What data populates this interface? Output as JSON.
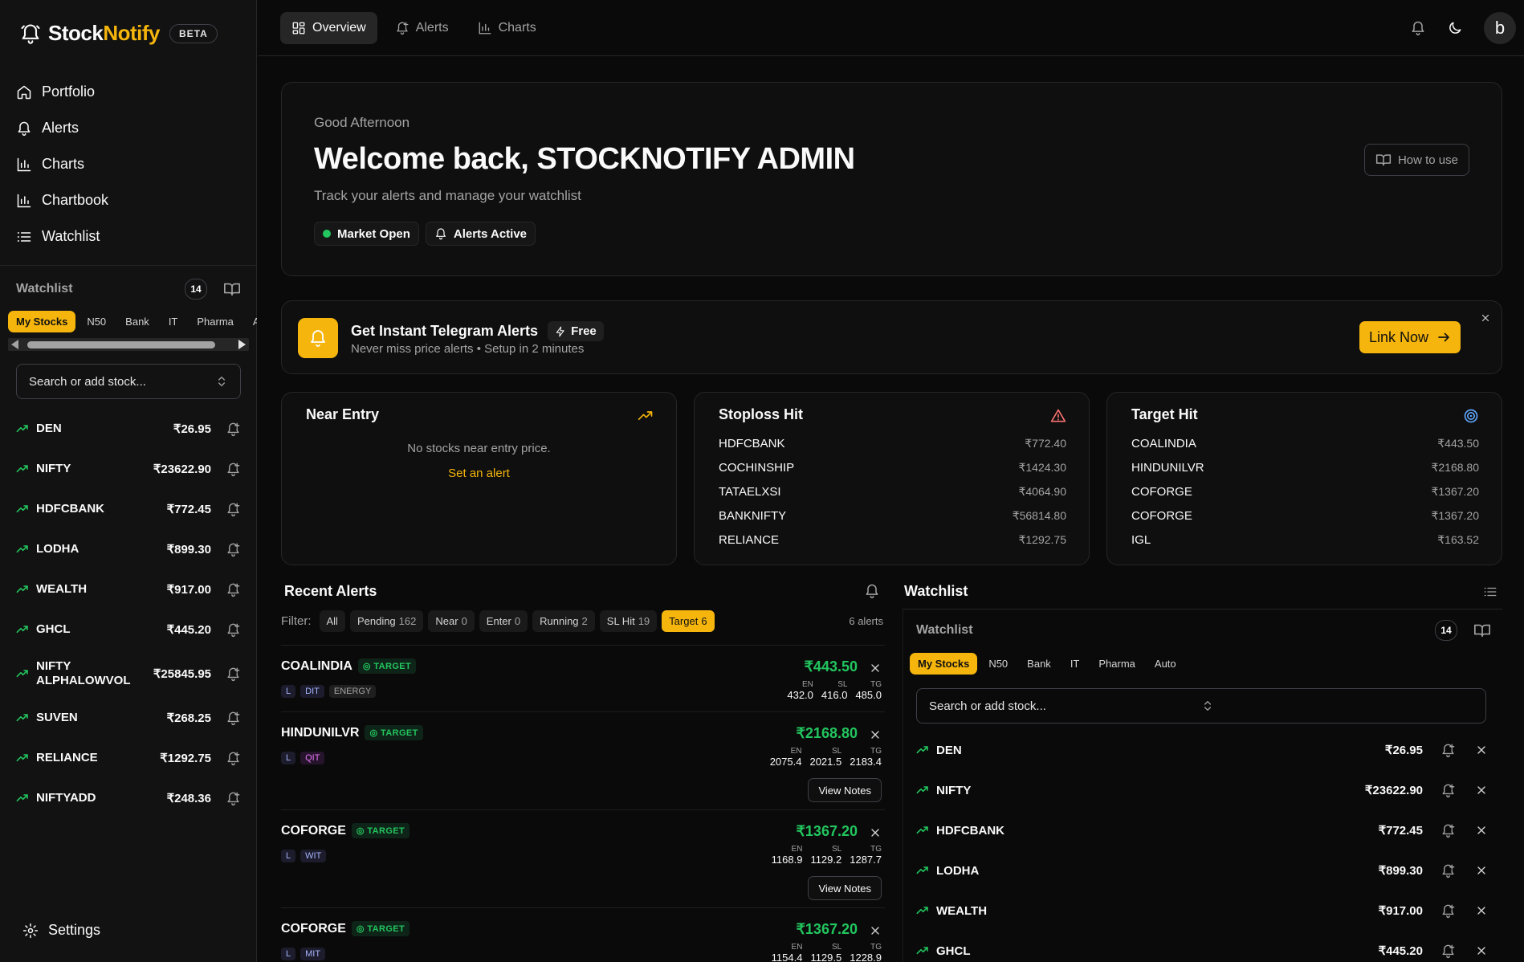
{
  "brand": {
    "name_a": "Stock",
    "name_b": "Notify",
    "badge": "BETA"
  },
  "colors": {
    "accent": "#f5b50c",
    "success": "#22c55e",
    "danger": "#f87171",
    "info": "#60a5fa",
    "bg": "#0a0a0a"
  },
  "nav": [
    {
      "label": "Portfolio",
      "icon": "home-icon"
    },
    {
      "label": "Alerts",
      "icon": "bell-icon"
    },
    {
      "label": "Charts",
      "icon": "bar-chart-icon"
    },
    {
      "label": "Chartbook",
      "icon": "bar-chart-icon"
    },
    {
      "label": "Watchlist",
      "icon": "list-icon"
    }
  ],
  "sidebar_watchlist": {
    "title": "Watchlist",
    "count": "14",
    "chips": [
      "My Stocks",
      "N50",
      "Bank",
      "IT",
      "Pharma",
      "A"
    ],
    "search_placeholder": "Search or add stock...",
    "stocks": [
      {
        "name": "DEN",
        "price": "₹26.95"
      },
      {
        "name": "NIFTY",
        "price": "₹23622.90"
      },
      {
        "name": "HDFCBANK",
        "price": "₹772.45"
      },
      {
        "name": "LODHA",
        "price": "₹899.30"
      },
      {
        "name": "WEALTH",
        "price": "₹917.00"
      },
      {
        "name": "GHCL",
        "price": "₹445.20"
      },
      {
        "name": "NIFTY ALPHALOWVOL",
        "price": "₹25845.95"
      },
      {
        "name": "SUVEN",
        "price": "₹268.25"
      },
      {
        "name": "RELIANCE",
        "price": "₹1292.75"
      },
      {
        "name": "NIFTYADD",
        "price": "₹248.36"
      }
    ]
  },
  "settings_label": "Settings",
  "topbar": {
    "tabs": [
      {
        "label": "Overview",
        "icon": "grid-icon"
      },
      {
        "label": "Alerts",
        "icon": "bell-plus-icon"
      },
      {
        "label": "Charts",
        "icon": "bar-chart-icon"
      }
    ],
    "avatar_letter": "b"
  },
  "welcome": {
    "greeting": "Good Afternoon",
    "title": "Welcome back, STOCKNOTIFY ADMIN",
    "subtitle": "Track your alerts and manage your watchlist",
    "market_badge": "Market Open",
    "alerts_badge": "Alerts Active",
    "howto_label": "How to use"
  },
  "telegram": {
    "title": "Get Instant Telegram Alerts",
    "free_label": "Free",
    "subtitle": "Never miss price alerts • Setup in 2 minutes",
    "button": "Link Now"
  },
  "near_entry": {
    "title": "Near Entry",
    "empty": "No stocks near entry price.",
    "link": "Set an alert"
  },
  "stoploss": {
    "title": "Stoploss Hit",
    "items": [
      {
        "name": "HDFCBANK",
        "price": "₹772.40"
      },
      {
        "name": "COCHINSHIP",
        "price": "₹1424.30"
      },
      {
        "name": "TATAELXSI",
        "price": "₹4064.90"
      },
      {
        "name": "BANKNIFTY",
        "price": "₹56814.80"
      },
      {
        "name": "RELIANCE",
        "price": "₹1292.75"
      }
    ]
  },
  "target": {
    "title": "Target Hit",
    "items": [
      {
        "name": "COALINDIA",
        "price": "₹443.50"
      },
      {
        "name": "HINDUNILVR",
        "price": "₹2168.80"
      },
      {
        "name": "COFORGE",
        "price": "₹1367.20"
      },
      {
        "name": "COFORGE",
        "price": "₹1367.20"
      },
      {
        "name": "IGL",
        "price": "₹163.52"
      }
    ]
  },
  "recent_alerts": {
    "title": "Recent Alerts",
    "filter_label": "Filter:",
    "filters": [
      {
        "label": "All",
        "count": ""
      },
      {
        "label": "Pending",
        "count": "162"
      },
      {
        "label": "Near",
        "count": "0"
      },
      {
        "label": "Enter",
        "count": "0"
      },
      {
        "label": "Running",
        "count": "2"
      },
      {
        "label": "SL Hit",
        "count": "19"
      },
      {
        "label": "Target",
        "count": "6"
      }
    ],
    "count_text": "6 alerts",
    "level_labels": {
      "en": "EN",
      "sl": "SL",
      "tg": "TG"
    },
    "view_notes": "View Notes",
    "items": [
      {
        "name": "COALINDIA",
        "status": "TARGET",
        "tags": [
          "L",
          "DIT",
          "ENERGY"
        ],
        "price": "₹443.50",
        "en": "432.0",
        "sl": "416.0",
        "tg": "485.0"
      },
      {
        "name": "HINDUNILVR",
        "status": "TARGET",
        "tags": [
          "L",
          "QIT"
        ],
        "price": "₹2168.80",
        "en": "2075.4",
        "sl": "2021.5",
        "tg": "2183.4"
      },
      {
        "name": "COFORGE",
        "status": "TARGET",
        "tags": [
          "L",
          "WIT"
        ],
        "price": "₹1367.20",
        "en": "1168.9",
        "sl": "1129.2",
        "tg": "1287.7"
      },
      {
        "name": "COFORGE",
        "status": "TARGET",
        "tags": [
          "L",
          "MIT"
        ],
        "price": "₹1367.20",
        "en": "1154.4",
        "sl": "1129.5",
        "tg": "1228.9"
      }
    ]
  },
  "right_watchlist": {
    "title": "Watchlist",
    "subtitle": "Watchlist",
    "count": "14",
    "chips": [
      "My Stocks",
      "N50",
      "Bank",
      "IT",
      "Pharma",
      "Auto"
    ],
    "search_placeholder": "Search or add stock...",
    "stocks": [
      {
        "name": "DEN",
        "price": "₹26.95"
      },
      {
        "name": "NIFTY",
        "price": "₹23622.90"
      },
      {
        "name": "HDFCBANK",
        "price": "₹772.45"
      },
      {
        "name": "LODHA",
        "price": "₹899.30"
      },
      {
        "name": "WEALTH",
        "price": "₹917.00"
      },
      {
        "name": "GHCL",
        "price": "₹445.20"
      }
    ]
  }
}
